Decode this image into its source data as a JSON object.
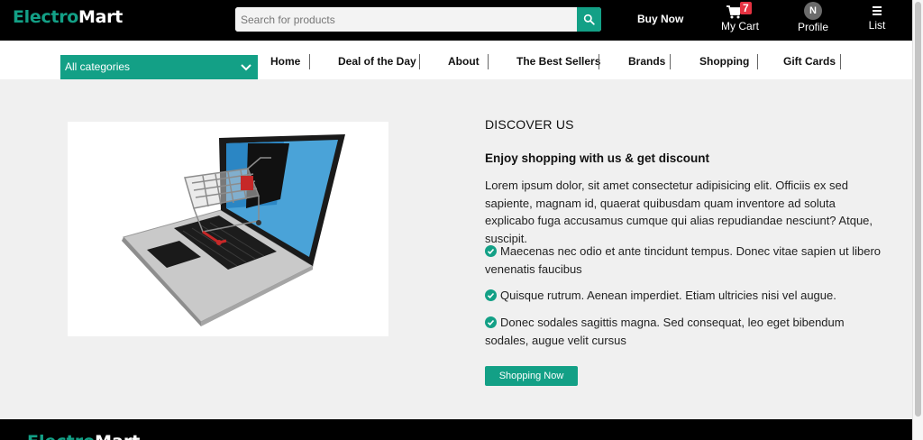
{
  "brand": {
    "logo_part1": "Electro",
    "logo_part2": "Mart"
  },
  "header": {
    "search_placeholder": "Search for products",
    "buy_now": "Buy Now",
    "cart_label": "My Cart",
    "cart_count": "7",
    "profile_label": "Profile",
    "profile_initial": "N",
    "list_label": "List"
  },
  "nav": {
    "category_select": "All categories",
    "items": [
      "Home",
      "Deal of the Day",
      "About",
      "The Best Sellers",
      "Brands",
      "Shopping",
      "Gift Cards"
    ]
  },
  "main": {
    "section_title": "DISCOVER US",
    "headline": "Enjoy shopping with us & get discount",
    "paragraph": "Lorem ipsum dolor, sit amet consectetur adipisicing elit. Officiis ex sed sapiente, magnam id, quaerat quibusdam quam inventore ad soluta explicabo fuga accusamus cumque qui alias repudiandae nesciunt? Atque, suscipit.",
    "bullets": [
      "Maecenas nec odio et ante tincidunt tempus. Donec vitae sapien ut libero venenatis faucibus",
      "Quisque rutrum. Aenean imperdiet. Etiam ultricies nisi vel augue.",
      "Donec sodales sagittis magna. Sed consequat, leo eget bibendum sodales, augue velit cursus"
    ],
    "cta": "Shopping Now"
  },
  "colors": {
    "accent": "#13a086",
    "topbar": "#000000",
    "badge": "#e53241",
    "background": "#f0f0f0"
  },
  "icons": [
    "search-icon",
    "cart-icon",
    "chevron-down-icon",
    "menu-icon",
    "check-circle-icon",
    "laptop-cart-illustration"
  ]
}
